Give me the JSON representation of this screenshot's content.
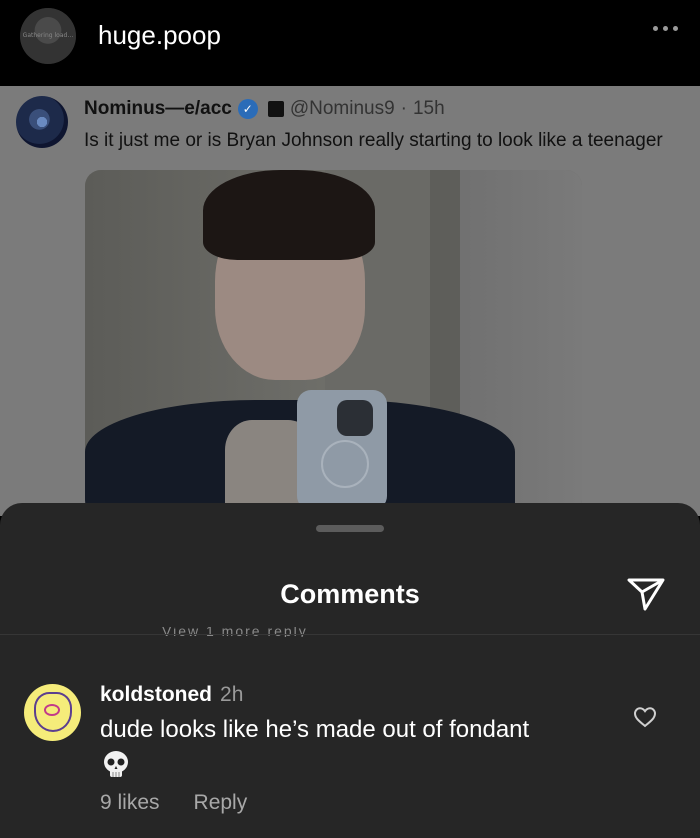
{
  "header": {
    "username": "huge.poop",
    "avatar_loading_text": "Gathering load…",
    "more_icon": "more-horizontal-icon"
  },
  "tweet": {
    "author_name": "Nominus—e/acc",
    "handle": "@Nominus9",
    "separator": "·",
    "time": "15h",
    "text": "Is it just me or is Bryan Johnson really starting to look like a teenager",
    "verified_icon": "verified-badge-icon",
    "image_alt": "Mirror selfie photo"
  },
  "comments_sheet": {
    "title": "Comments",
    "share_icon": "paper-plane-icon",
    "cutoff_text": "View 1 more reply",
    "comment": {
      "username": "koldstoned",
      "time": "2h",
      "text": "dude looks like he’s made out of fondant",
      "emoji": "💀",
      "likes": "9 likes",
      "reply_label": "Reply",
      "heart_icon": "heart-outline-icon"
    }
  },
  "colors": {
    "background": "#000000",
    "sheet": "#262626",
    "dimmed_tweet": "#7b7b7b",
    "secondary_text": "#a8a8a8",
    "verified": "#2b6cb8"
  }
}
